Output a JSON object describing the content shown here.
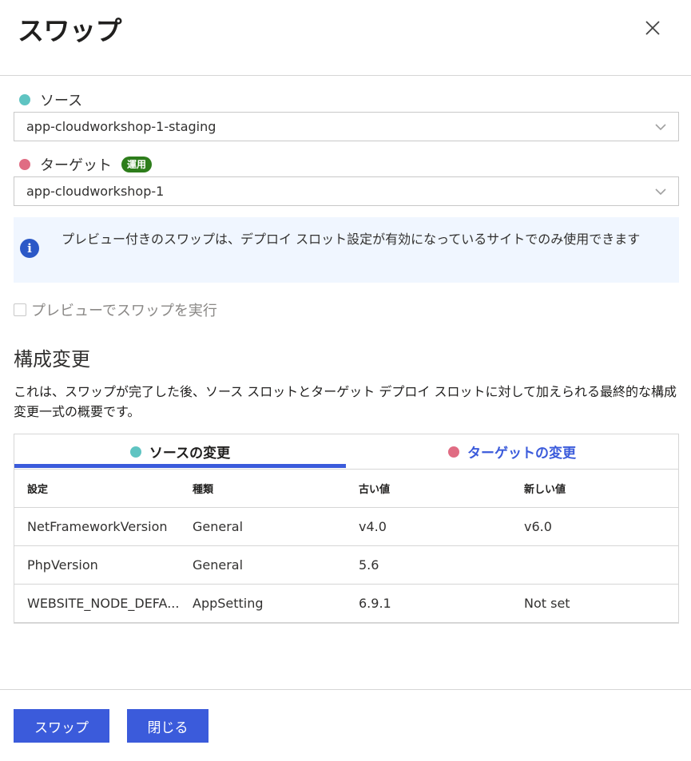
{
  "dialog": {
    "title": "スワップ"
  },
  "source": {
    "label": "ソース",
    "dot_color": "#5fc4c2",
    "selected": "app-cloudworkshop-1-staging"
  },
  "target": {
    "label": "ターゲット",
    "dot_color": "#e06c83",
    "badge": "運用",
    "badge_color": "#2d7d1b",
    "selected": "app-cloudworkshop-1"
  },
  "info": {
    "icon": "info-icon",
    "text": "プレビュー付きのスワップは、デプロイ スロット設定が有効になっているサイトでのみ使用できます"
  },
  "preview_checkbox": {
    "label": "プレビューでスワップを実行",
    "checked": false
  },
  "config_changes": {
    "title": "構成変更",
    "description": "これは、スワップが完了した後、ソース スロットとターゲット デプロイ スロットに対して加えられる最終的な構成変更一式の概要です。",
    "tabs": [
      {
        "label": "ソースの変更",
        "active": true
      },
      {
        "label": "ターゲットの変更",
        "active": false
      }
    ],
    "columns": [
      "設定",
      "種類",
      "古い値",
      "新しい値"
    ],
    "rows": [
      [
        "NetFrameworkVersion",
        "General",
        "v4.0",
        "v6.0"
      ],
      [
        "PhpVersion",
        "General",
        "5.6",
        ""
      ],
      [
        "WEBSITE_NODE_DEFA...",
        "AppSetting",
        "6.9.1",
        "Not set"
      ]
    ]
  },
  "footer": {
    "swap_label": "スワップ",
    "close_label": "閉じる"
  },
  "colors": {
    "accent": "#3b5bdb"
  }
}
